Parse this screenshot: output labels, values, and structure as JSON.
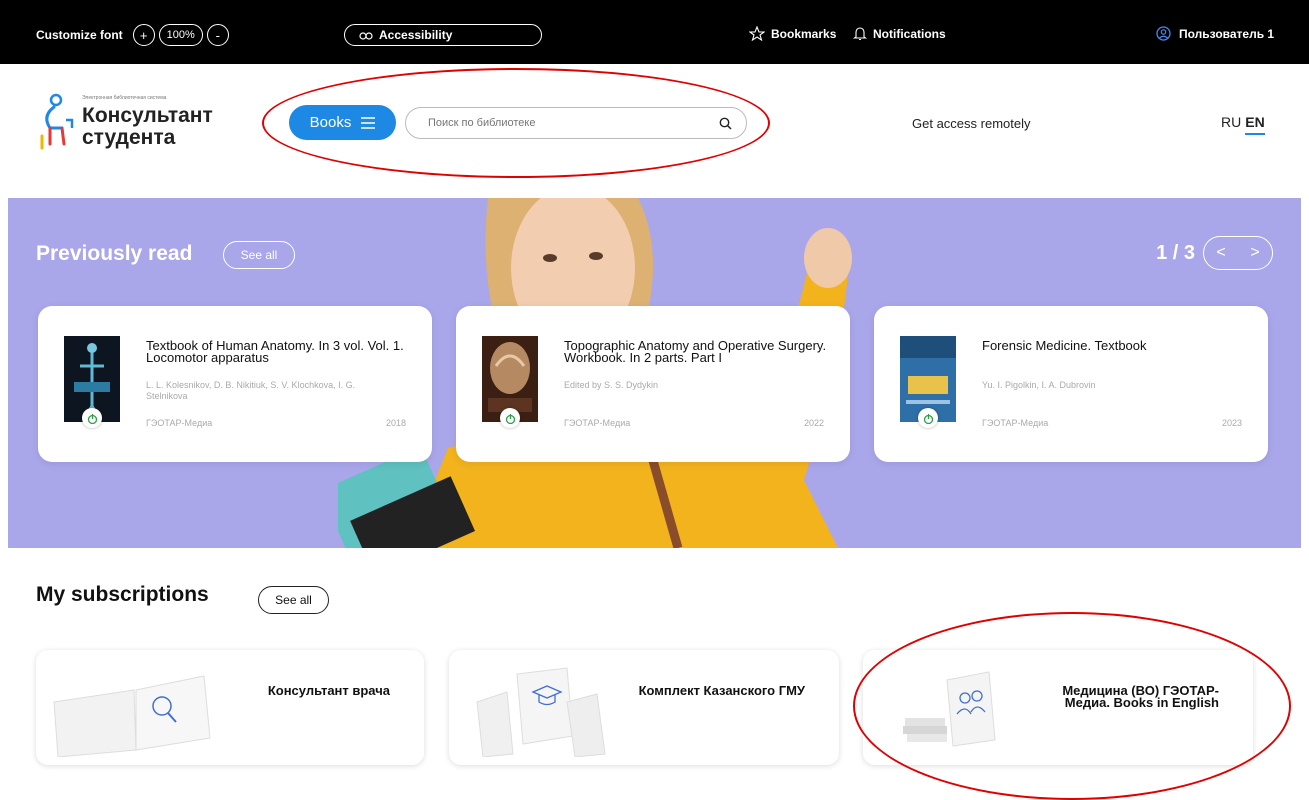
{
  "topbar": {
    "customize_font": "Customize font",
    "plus": "+",
    "zoom": "100%",
    "minus": "-",
    "accessibility": "Accessibility",
    "bookmarks": "Bookmarks",
    "notifications": "Notifications",
    "user": "Пользователь 1"
  },
  "header": {
    "logo_small": "Электронная библиотечная система",
    "logo_line1": "Консультант",
    "logo_line2": "студента",
    "books_button": "Books",
    "search_placeholder": "Поиск по библиотеке",
    "remote_access": "Get access remotely",
    "lang_ru": "RU",
    "lang_en": "EN"
  },
  "hero": {
    "title": "Previously read",
    "see_all": "See all",
    "pager": "1 / 3",
    "prev": "<",
    "next": ">"
  },
  "books": [
    {
      "title": "Textbook of Human Anatomy. In 3 vol. Vol. 1. Locomotor apparatus",
      "authors": "L. L. Kolesnikov, D. B. Nikitiuk, S. V. Klochkova, I. G. Stelnikova",
      "publisher": "ГЭОТАР-Медиа",
      "year": "2018"
    },
    {
      "title": "Topographic Anatomy and Operative Surgery. Workbook. In 2 parts. Part I",
      "authors": "Edited by S. S. Dydykin",
      "publisher": "ГЭОТАР-Медиа",
      "year": "2022"
    },
    {
      "title": "Forensic Medicine. Textbook",
      "authors": "Yu. I. Pigolkin, I. A. Dubrovin",
      "publisher": "ГЭОТАР-Медиа",
      "year": "2023"
    }
  ],
  "subscriptions": {
    "title": "My subscriptions",
    "see_all": "See all",
    "items": [
      {
        "label": "Консультант врача"
      },
      {
        "label": "Комплект Казанского ГМУ"
      },
      {
        "label": "Медицина (ВО) ГЭОТАР-Медиа. Books in English"
      }
    ]
  },
  "colors": {
    "accent": "#1e88e5",
    "hero_bg": "#a9a6ea",
    "annotation": "#e00000"
  }
}
